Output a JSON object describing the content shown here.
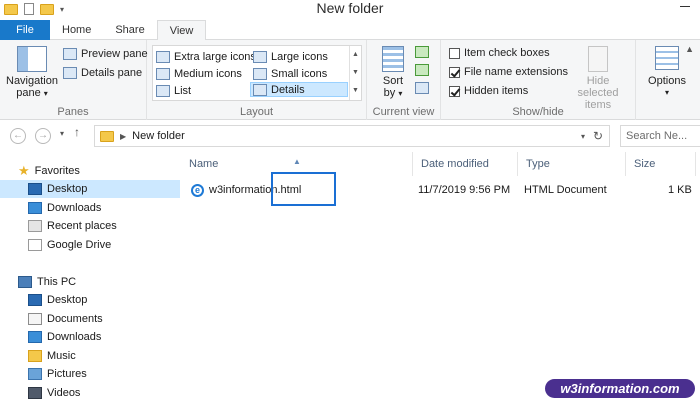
{
  "window": {
    "title": "New folder"
  },
  "ribbon_tabs": [
    {
      "label": "File"
    },
    {
      "label": "Home"
    },
    {
      "label": "Share"
    },
    {
      "label": "View"
    }
  ],
  "panes_group": {
    "navigation_pane_label": "Navigation",
    "navigation_pane_label2": "pane",
    "preview_pane_label": "Preview pane",
    "details_pane_label": "Details pane",
    "group_label": "Panes"
  },
  "layout_group": {
    "items": [
      {
        "label": "Extra large icons"
      },
      {
        "label": "Large icons"
      },
      {
        "label": "Medium icons"
      },
      {
        "label": "Small icons"
      },
      {
        "label": "List"
      },
      {
        "label": "Details"
      }
    ],
    "selected": "Details",
    "group_label": "Layout"
  },
  "current_view_group": {
    "sort_label": "Sort",
    "sort_label2": "by",
    "group_label": "Current view"
  },
  "show_hide_group": {
    "item_check_boxes": {
      "label": "Item check boxes",
      "checked": false
    },
    "file_name_extensions": {
      "label": "File name extensions",
      "checked": true
    },
    "hidden_items": {
      "label": "Hidden items",
      "checked": true
    },
    "hide_selected_label": "Hide selected",
    "hide_selected_label2": "items",
    "group_label": "Show/hide"
  },
  "options_group": {
    "options_label": "Options"
  },
  "address_bar": {
    "path": "New folder",
    "search_placeholder": "Search Ne..."
  },
  "nav_pane": {
    "favorites_label": "Favorites",
    "favorites": [
      {
        "label": "Desktop",
        "icon": "desktop-icon"
      },
      {
        "label": "Downloads",
        "icon": "downloads-icon"
      },
      {
        "label": "Recent places",
        "icon": "recent-places-icon"
      },
      {
        "label": "Google Drive",
        "icon": "google-drive-icon"
      }
    ],
    "this_pc_label": "This PC",
    "this_pc": [
      {
        "label": "Desktop",
        "icon": "desktop-icon"
      },
      {
        "label": "Documents",
        "icon": "documents-icon"
      },
      {
        "label": "Downloads",
        "icon": "downloads-icon"
      },
      {
        "label": "Music",
        "icon": "music-icon"
      },
      {
        "label": "Pictures",
        "icon": "pictures-icon"
      },
      {
        "label": "Videos",
        "icon": "videos-icon"
      }
    ]
  },
  "file_list": {
    "columns": [
      "Name",
      "Date modified",
      "Type",
      "Size"
    ],
    "rows": [
      {
        "name_base": "w3information",
        "name_ext": ".html",
        "date_modified": "11/7/2019 9:56 PM",
        "type": "HTML Document",
        "size": "1 KB"
      }
    ]
  },
  "watermark": {
    "text": "w3information.com"
  },
  "colors": {
    "file_tab": "#1979ca",
    "selection": "#cce8ff",
    "highlight_box": "#1a6fd4",
    "watermark_bg": "#4a2f8f"
  }
}
